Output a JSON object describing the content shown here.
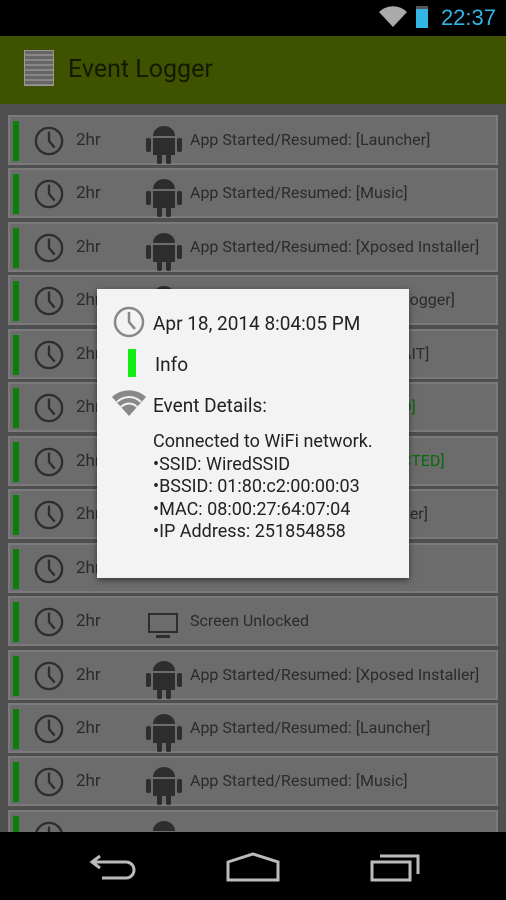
{
  "status_bar": {
    "time": "22:37",
    "icons": [
      "wifi-icon",
      "battery-icon"
    ]
  },
  "action_bar": {
    "title": "Event Logger",
    "icon": "log-document-icon"
  },
  "accent": {
    "header": "#3f5200",
    "level_info": "#11ee11",
    "row_bar": "#0a7f0a",
    "clock": "#33b5e5"
  },
  "events": [
    {
      "age": "2hr",
      "icon": "android-icon",
      "text": "App Started/Resumed: [Launcher]"
    },
    {
      "age": "2hr",
      "icon": "android-icon",
      "text": "App Started/Resumed: [Music]"
    },
    {
      "age": "2hr",
      "icon": "android-icon",
      "text": "App Started/Resumed: [Xposed Installer]"
    },
    {
      "age": "2hr",
      "icon": "android-icon",
      "text": "Logger]",
      "partial": true
    },
    {
      "age": "2hr",
      "icon": "",
      "text": "AIT]",
      "partial": true
    },
    {
      "age": "2hr",
      "icon": "",
      "text": "D]",
      "partial": true,
      "green": true
    },
    {
      "age": "2hr",
      "icon": "",
      "text": "CTED]",
      "partial": true,
      "green": true
    },
    {
      "age": "2hr",
      "icon": "",
      "text": "her]",
      "partial": true
    },
    {
      "age": "2hr",
      "icon": "",
      "text": ""
    },
    {
      "age": "2hr",
      "icon": "monitor-icon",
      "text": "Screen Unlocked"
    },
    {
      "age": "2hr",
      "icon": "android-icon",
      "text": "App Started/Resumed: [Xposed Installer]"
    },
    {
      "age": "2hr",
      "icon": "android-icon",
      "text": "App Started/Resumed: [Launcher]"
    },
    {
      "age": "2hr",
      "icon": "android-icon",
      "text": "App Started/Resumed: [Music]"
    },
    {
      "age": "",
      "icon": "android-icon",
      "text": ""
    }
  ],
  "dialog": {
    "date": "Apr 18, 2014 8:04:05 PM",
    "level": "Info",
    "details_label": "Event Details:",
    "lines": [
      "Connected to WiFi network.",
      "•SSID: WiredSSID",
      "•BSSID: 01:80:c2:00:00:03",
      "•MAC: 08:00:27:64:07:04",
      "•IP Address: 251854858"
    ]
  },
  "nav_bar": {
    "buttons": [
      "back",
      "home",
      "recent-apps"
    ]
  }
}
